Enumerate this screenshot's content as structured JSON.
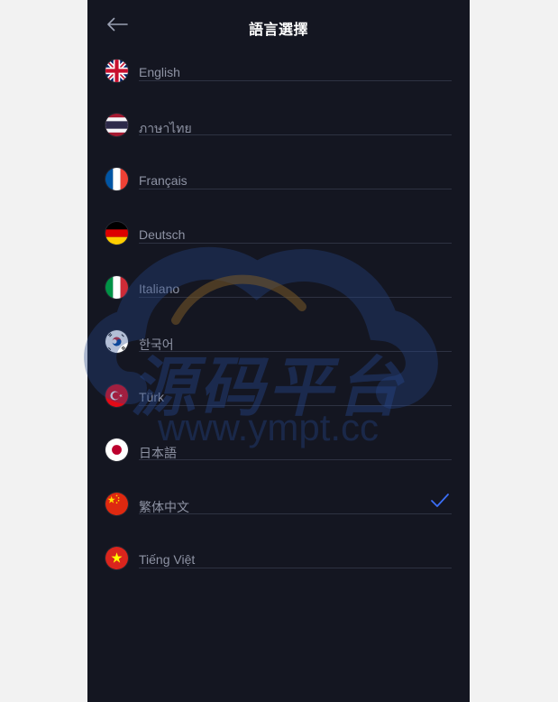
{
  "header": {
    "title": "語言選擇",
    "back_icon": "arrow-left-icon"
  },
  "languages": [
    {
      "label": "English",
      "flag": "uk-flag-icon",
      "selected": false
    },
    {
      "label": "ภาษาไทย",
      "flag": "thailand-flag-icon",
      "selected": false
    },
    {
      "label": "Français",
      "flag": "france-flag-icon",
      "selected": false
    },
    {
      "label": "Deutsch",
      "flag": "germany-flag-icon",
      "selected": false
    },
    {
      "label": "Italiano",
      "flag": "italy-flag-icon",
      "selected": false
    },
    {
      "label": "한국어",
      "flag": "korea-flag-icon",
      "selected": false
    },
    {
      "label": "Türk",
      "flag": "turkey-flag-icon",
      "selected": false
    },
    {
      "label": "日本語",
      "flag": "japan-flag-icon",
      "selected": false
    },
    {
      "label": "繁体中文",
      "flag": "china-flag-icon",
      "selected": true
    },
    {
      "label": "Tiếng Việt",
      "flag": "vietnam-flag-icon",
      "selected": false
    }
  ],
  "watermark": {
    "text": "源码平台",
    "url": "www.ympt.cc"
  },
  "colors": {
    "background": "#141621",
    "label": "#8e93a4",
    "divider": "#2e3242",
    "check": "#3b6ef5"
  }
}
